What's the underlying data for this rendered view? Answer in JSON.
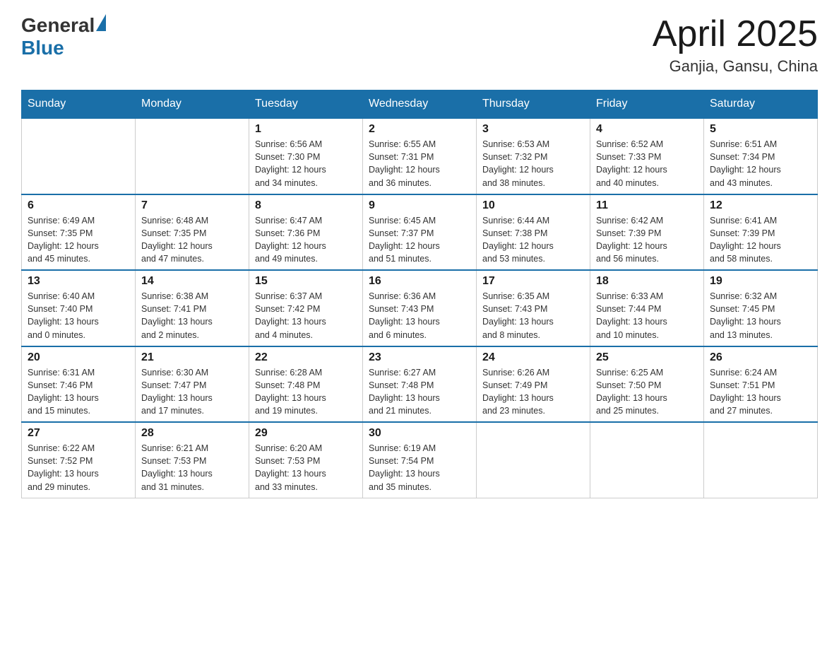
{
  "header": {
    "logo_general": "General",
    "logo_blue": "Blue",
    "title": "April 2025",
    "subtitle": "Ganjia, Gansu, China"
  },
  "weekdays": [
    "Sunday",
    "Monday",
    "Tuesday",
    "Wednesday",
    "Thursday",
    "Friday",
    "Saturday"
  ],
  "weeks": [
    [
      {
        "day": "",
        "info": ""
      },
      {
        "day": "",
        "info": ""
      },
      {
        "day": "1",
        "info": "Sunrise: 6:56 AM\nSunset: 7:30 PM\nDaylight: 12 hours\nand 34 minutes."
      },
      {
        "day": "2",
        "info": "Sunrise: 6:55 AM\nSunset: 7:31 PM\nDaylight: 12 hours\nand 36 minutes."
      },
      {
        "day": "3",
        "info": "Sunrise: 6:53 AM\nSunset: 7:32 PM\nDaylight: 12 hours\nand 38 minutes."
      },
      {
        "day": "4",
        "info": "Sunrise: 6:52 AM\nSunset: 7:33 PM\nDaylight: 12 hours\nand 40 minutes."
      },
      {
        "day": "5",
        "info": "Sunrise: 6:51 AM\nSunset: 7:34 PM\nDaylight: 12 hours\nand 43 minutes."
      }
    ],
    [
      {
        "day": "6",
        "info": "Sunrise: 6:49 AM\nSunset: 7:35 PM\nDaylight: 12 hours\nand 45 minutes."
      },
      {
        "day": "7",
        "info": "Sunrise: 6:48 AM\nSunset: 7:35 PM\nDaylight: 12 hours\nand 47 minutes."
      },
      {
        "day": "8",
        "info": "Sunrise: 6:47 AM\nSunset: 7:36 PM\nDaylight: 12 hours\nand 49 minutes."
      },
      {
        "day": "9",
        "info": "Sunrise: 6:45 AM\nSunset: 7:37 PM\nDaylight: 12 hours\nand 51 minutes."
      },
      {
        "day": "10",
        "info": "Sunrise: 6:44 AM\nSunset: 7:38 PM\nDaylight: 12 hours\nand 53 minutes."
      },
      {
        "day": "11",
        "info": "Sunrise: 6:42 AM\nSunset: 7:39 PM\nDaylight: 12 hours\nand 56 minutes."
      },
      {
        "day": "12",
        "info": "Sunrise: 6:41 AM\nSunset: 7:39 PM\nDaylight: 12 hours\nand 58 minutes."
      }
    ],
    [
      {
        "day": "13",
        "info": "Sunrise: 6:40 AM\nSunset: 7:40 PM\nDaylight: 13 hours\nand 0 minutes."
      },
      {
        "day": "14",
        "info": "Sunrise: 6:38 AM\nSunset: 7:41 PM\nDaylight: 13 hours\nand 2 minutes."
      },
      {
        "day": "15",
        "info": "Sunrise: 6:37 AM\nSunset: 7:42 PM\nDaylight: 13 hours\nand 4 minutes."
      },
      {
        "day": "16",
        "info": "Sunrise: 6:36 AM\nSunset: 7:43 PM\nDaylight: 13 hours\nand 6 minutes."
      },
      {
        "day": "17",
        "info": "Sunrise: 6:35 AM\nSunset: 7:43 PM\nDaylight: 13 hours\nand 8 minutes."
      },
      {
        "day": "18",
        "info": "Sunrise: 6:33 AM\nSunset: 7:44 PM\nDaylight: 13 hours\nand 10 minutes."
      },
      {
        "day": "19",
        "info": "Sunrise: 6:32 AM\nSunset: 7:45 PM\nDaylight: 13 hours\nand 13 minutes."
      }
    ],
    [
      {
        "day": "20",
        "info": "Sunrise: 6:31 AM\nSunset: 7:46 PM\nDaylight: 13 hours\nand 15 minutes."
      },
      {
        "day": "21",
        "info": "Sunrise: 6:30 AM\nSunset: 7:47 PM\nDaylight: 13 hours\nand 17 minutes."
      },
      {
        "day": "22",
        "info": "Sunrise: 6:28 AM\nSunset: 7:48 PM\nDaylight: 13 hours\nand 19 minutes."
      },
      {
        "day": "23",
        "info": "Sunrise: 6:27 AM\nSunset: 7:48 PM\nDaylight: 13 hours\nand 21 minutes."
      },
      {
        "day": "24",
        "info": "Sunrise: 6:26 AM\nSunset: 7:49 PM\nDaylight: 13 hours\nand 23 minutes."
      },
      {
        "day": "25",
        "info": "Sunrise: 6:25 AM\nSunset: 7:50 PM\nDaylight: 13 hours\nand 25 minutes."
      },
      {
        "day": "26",
        "info": "Sunrise: 6:24 AM\nSunset: 7:51 PM\nDaylight: 13 hours\nand 27 minutes."
      }
    ],
    [
      {
        "day": "27",
        "info": "Sunrise: 6:22 AM\nSunset: 7:52 PM\nDaylight: 13 hours\nand 29 minutes."
      },
      {
        "day": "28",
        "info": "Sunrise: 6:21 AM\nSunset: 7:53 PM\nDaylight: 13 hours\nand 31 minutes."
      },
      {
        "day": "29",
        "info": "Sunrise: 6:20 AM\nSunset: 7:53 PM\nDaylight: 13 hours\nand 33 minutes."
      },
      {
        "day": "30",
        "info": "Sunrise: 6:19 AM\nSunset: 7:54 PM\nDaylight: 13 hours\nand 35 minutes."
      },
      {
        "day": "",
        "info": ""
      },
      {
        "day": "",
        "info": ""
      },
      {
        "day": "",
        "info": ""
      }
    ]
  ]
}
